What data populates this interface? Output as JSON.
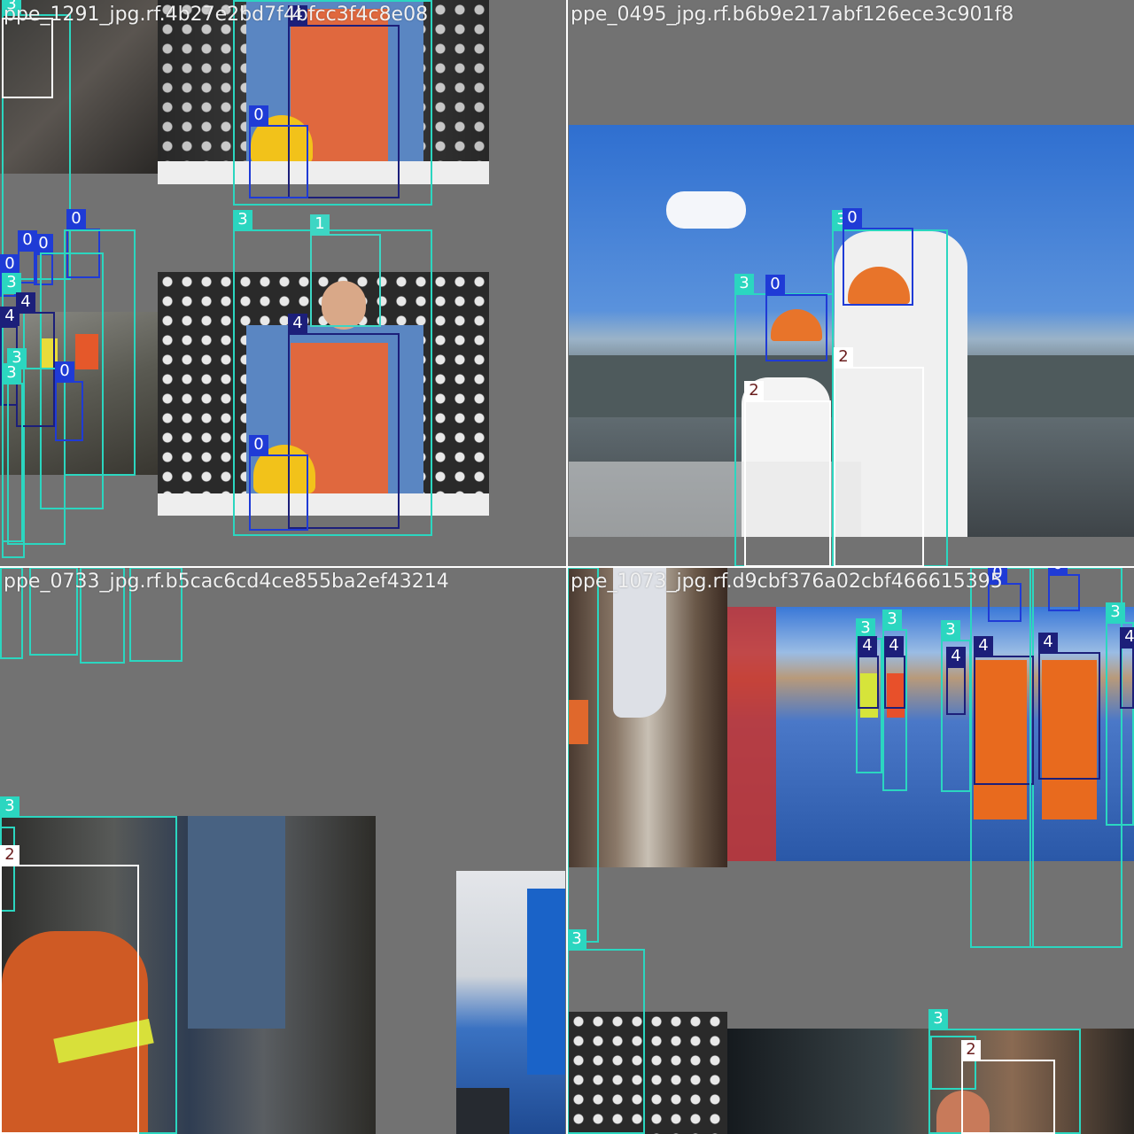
{
  "tiles": [
    {
      "title": "ppe_1291_jpg.rf.4b27e2bd7f4bfcc3f4c8e08"
    },
    {
      "title": "ppe_0495_jpg.rf.b6b9e217abf126ece3c901f8"
    },
    {
      "title": "ppe_0733_jpg.rf.b5cac6cd4ce855ba2ef43214"
    },
    {
      "title": "ppe_1073_jpg.rf.d9cbf376a02cbf466615395"
    }
  ],
  "class_colors": {
    "0": "#1f3bd6",
    "1": "#3dd6c4",
    "2": "#ffffff",
    "3": "#2bd6c0",
    "4": "#1c1f7a"
  },
  "labels": {
    "c0": "0",
    "c1": "1",
    "c2": "2",
    "c3": "3",
    "c4": "4"
  }
}
